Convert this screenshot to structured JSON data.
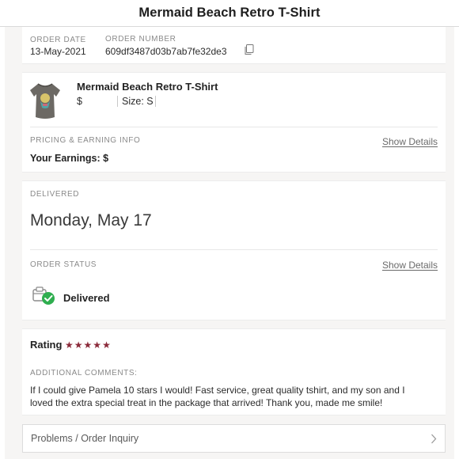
{
  "header": {
    "title": "Mermaid Beach Retro T-Shirt"
  },
  "order": {
    "date_label": "ORDER DATE",
    "date_value": "13-May-2021",
    "number_label": "ORDER NUMBER",
    "number_value": "609df3487d03b7ab7fe32de3"
  },
  "item": {
    "name": "Mermaid Beach Retro T-Shirt",
    "price": "$",
    "size": "Size: S"
  },
  "pricing": {
    "label": "PRICING & EARNING INFO",
    "show_details": "Show Details",
    "earnings": "Your Earnings: $"
  },
  "delivery": {
    "label": "DELIVERED",
    "date": "Monday, May 17",
    "status_label": "ORDER STATUS",
    "show_details": "Show Details",
    "status": "Delivered"
  },
  "rating": {
    "label": "Rating",
    "stars": 5,
    "star_color": "#8b2a3a",
    "comments_label": "ADDITIONAL COMMENTS:",
    "comment": "If I could give Pamela 10 stars I would! Fast service, great quality tshirt, and my son and I loved the extra special treat in the package that arrived! Thank you, made me smile!"
  },
  "inquiry": {
    "label": "Problems / Order Inquiry"
  },
  "colors": {
    "accent_green": "#2fae4f",
    "star": "#8b2a3a"
  }
}
